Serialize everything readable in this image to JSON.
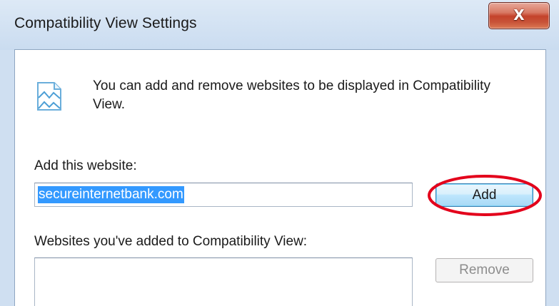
{
  "window": {
    "title": "Compatibility View Settings",
    "close_glyph": "X"
  },
  "info": {
    "icon": "compatibility-view-icon",
    "text": "You can add and remove websites to be displayed in Compatibility View."
  },
  "add_site": {
    "label": "Add this website:",
    "value": "secureinternetbank.com",
    "add_label": "Add"
  },
  "added_sites": {
    "label": "Websites you've added to Compatibility View:",
    "items": [],
    "remove_label": "Remove",
    "remove_disabled": true
  },
  "highlight": {
    "color": "#e3001b",
    "target": "add-button"
  }
}
